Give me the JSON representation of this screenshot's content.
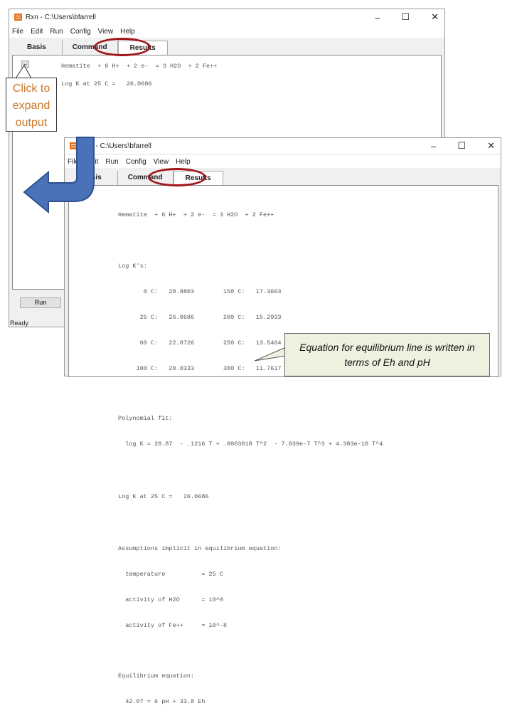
{
  "window1": {
    "title": "Rxn - C:\\Users\\bfarrell",
    "menu": [
      "File",
      "Edit",
      "Run",
      "Config",
      "View",
      "Help"
    ],
    "tabs": [
      "Basis",
      "Command",
      "Results"
    ],
    "active_tab": "Results",
    "collapse_button": "−",
    "lines": [
      "Hematite  + 6 H+  + 2 e-  = 3 H2O  + 2 Fe++",
      "Log K at 25 C =   26.0686"
    ],
    "run_label": "Run",
    "status": "Ready"
  },
  "window2": {
    "title": "Rxn - C:\\Users\\bfarrell",
    "menu": [
      "File",
      "Edit",
      "Run",
      "Config",
      "View",
      "Help"
    ],
    "tabs": [
      "Basis",
      "Command",
      "Results"
    ],
    "active_tab": "Results",
    "reaction": "Hematite  + 6 H+  + 2 e-  = 3 H2O  + 2 Fe++",
    "logk_header": "Log K's:",
    "logk_rows": [
      "       0 C:   28.8803        150 C:   17.3663",
      "      25 C:   26.0686        200 C:   15.2933",
      "      60 C:   22.8726        250 C:   13.5464",
      "     100 C:   20.0333        300 C:   11.7617"
    ],
    "poly_header": "Polynomial fit:",
    "poly": "  log K = 28.87  - .1216 T + .0003018 T^2  - 7.839e-7 T^3 + 4.383e-10 T^4",
    "logk25": "Log K at 25 C =   26.0686",
    "assump_header": "Assumptions implicit in equilibrium equation:",
    "assump": [
      "  temperature          = 25 C",
      "  activity of H2O      = 10^0",
      "  activity of Fe++     = 10^-8"
    ],
    "eq_header": "Equilibrium equation:",
    "eq": "  42.07 = 6 pH + 33.8 Eh"
  },
  "callouts": {
    "expand": "Click to expand output",
    "equation": "Equation for equilibrium line is written in terms of Eh and pH"
  },
  "colors": {
    "highlight": "#a0161a",
    "callout_text": "#c8782a",
    "arrow": "#4a72b8",
    "note_bg": "#eef0e0"
  }
}
